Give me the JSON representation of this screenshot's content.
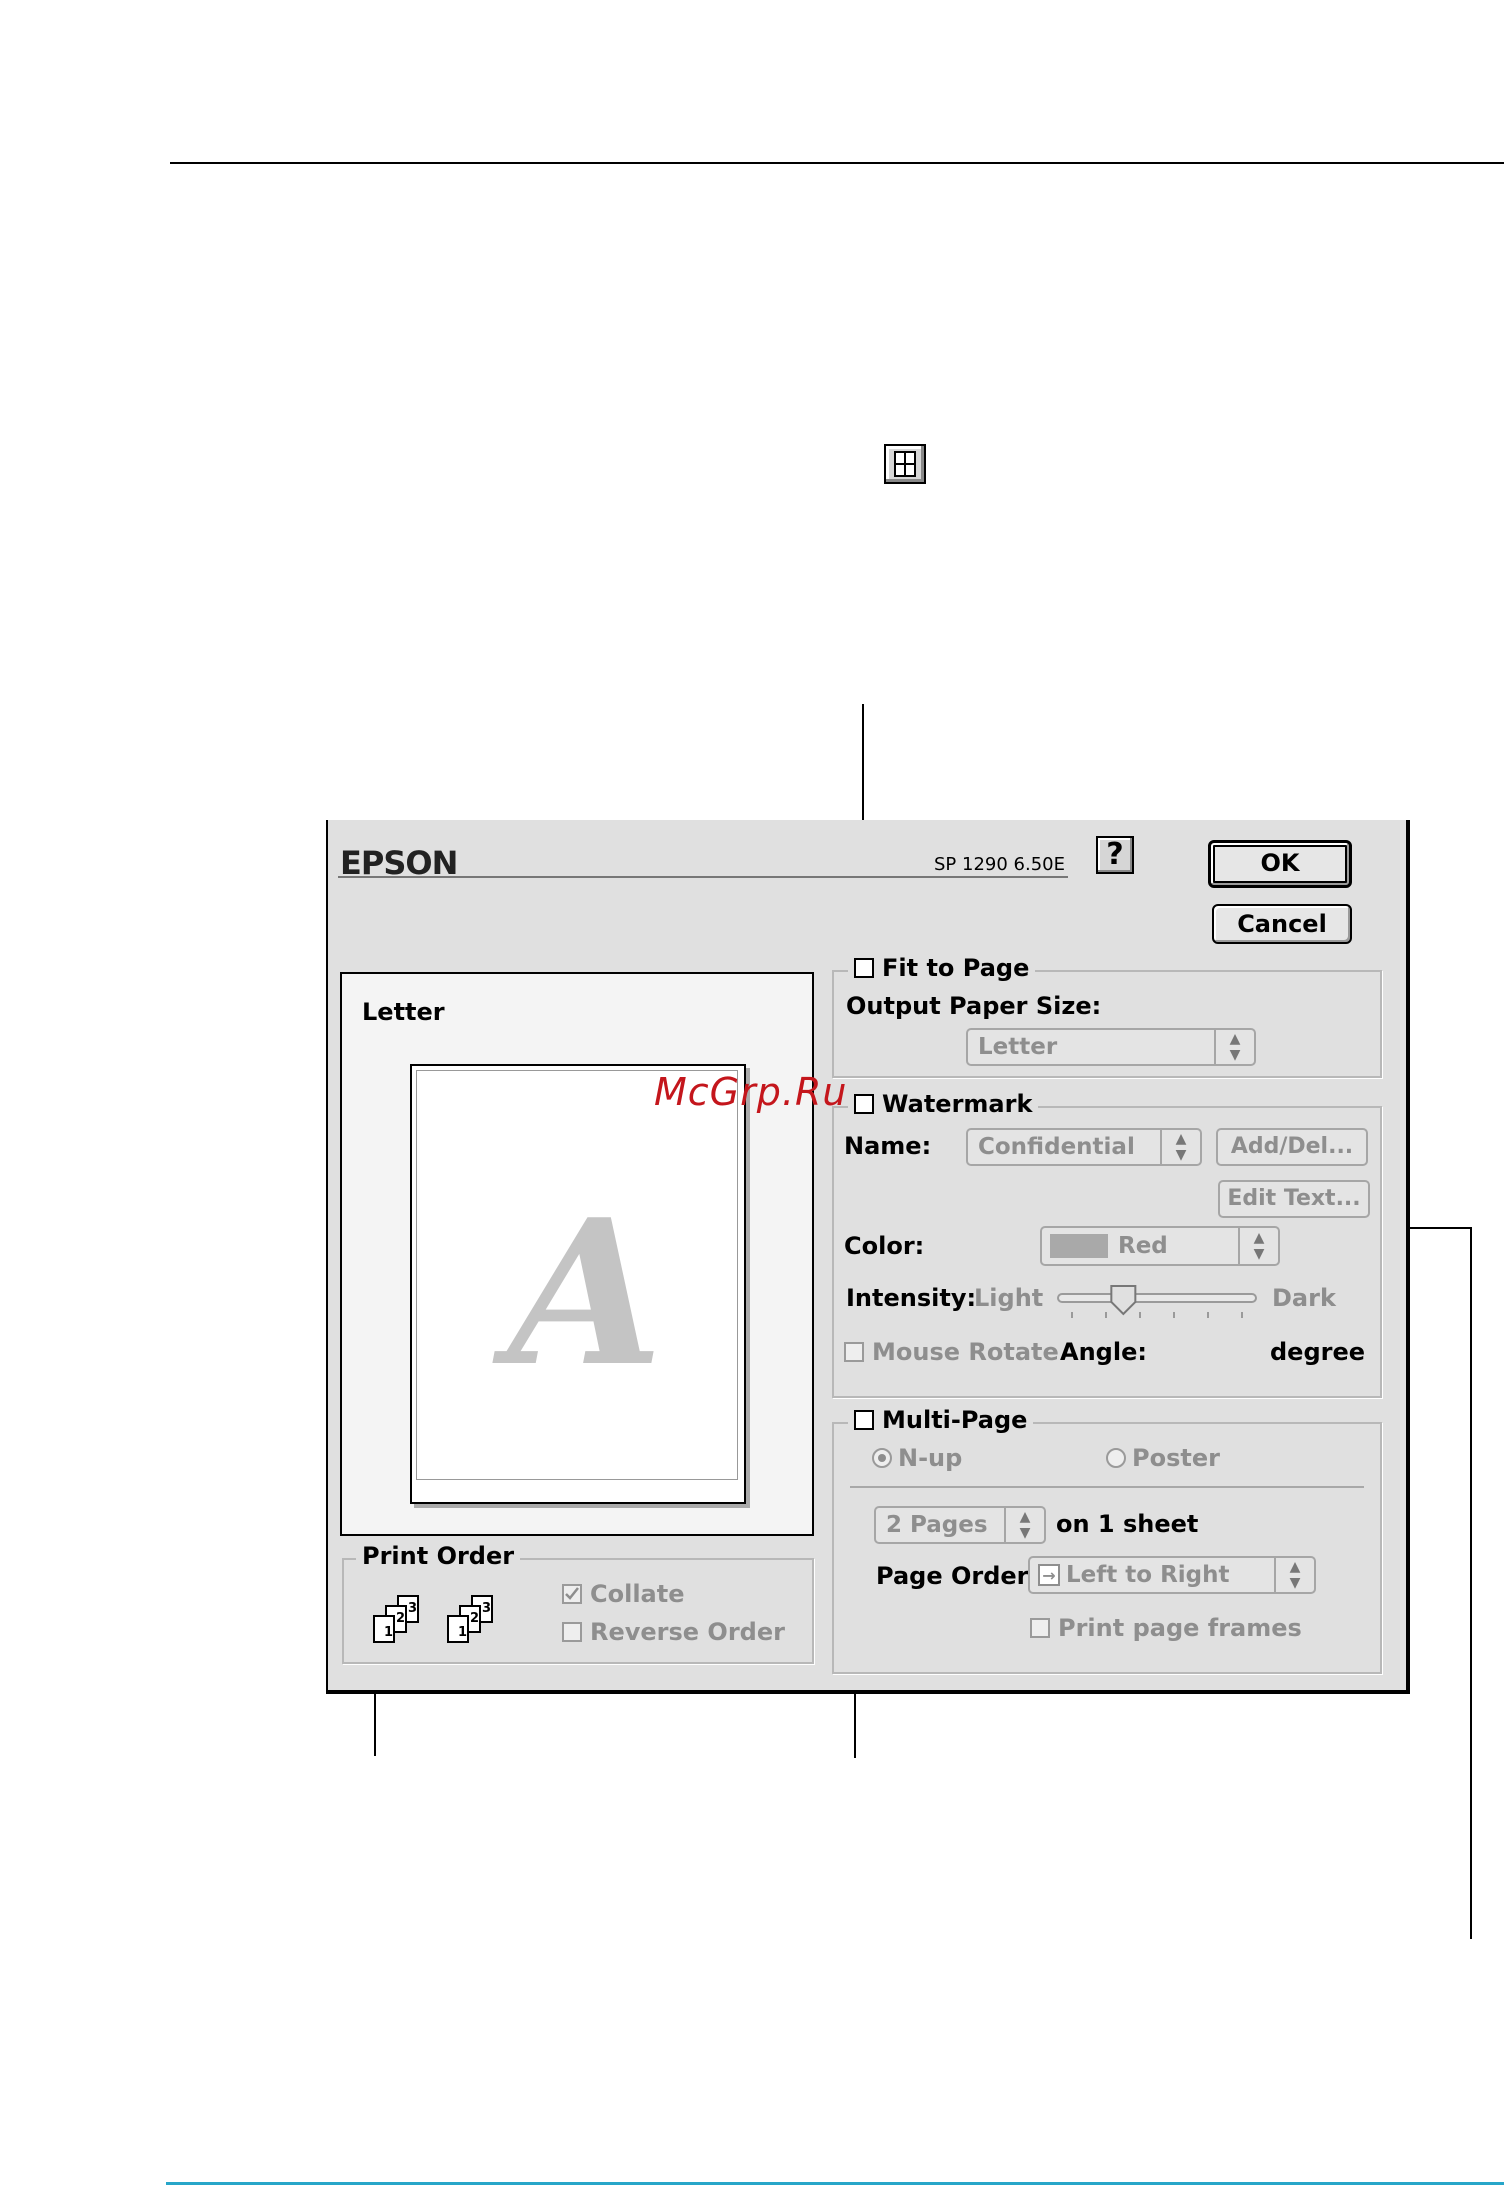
{
  "dialog": {
    "brand": "EPSON",
    "version": "SP 1290 6.50E",
    "help_label": "?",
    "ok_label": "OK",
    "cancel_label": "Cancel",
    "preview": {
      "paper_label": "Letter",
      "watermark_glyph": "A"
    },
    "fit_to_page": {
      "label": "Fit to Page",
      "output_paper_size_label": "Output Paper Size:",
      "output_paper_size_value": "Letter"
    },
    "watermark": {
      "label": "Watermark",
      "name_label": "Name:",
      "name_value": "Confidential",
      "add_del_label": "Add/Del...",
      "edit_text_label": "Edit Text...",
      "color_label": "Color:",
      "color_value": "Red",
      "intensity_label": "Intensity:",
      "light_label": "Light",
      "dark_label": "Dark",
      "intensity_level": 0.33,
      "mouse_rotate_label": "Mouse Rotate",
      "angle_label": "Angle:",
      "degree_label": "degree"
    },
    "multi_page": {
      "label": "Multi-Page",
      "nup_label": "N-up",
      "poster_label": "Poster",
      "pages_value": "2 Pages",
      "on_sheet_label": "on 1 sheet",
      "page_order_label": "Page Order:",
      "page_order_value": "Left to Right",
      "print_frames_label": "Print page frames"
    },
    "print_order": {
      "label": "Print Order",
      "collate_label": "Collate",
      "collate_checked": true,
      "reverse_label": "Reverse Order",
      "reverse_checked": false,
      "icon_digits": [
        "1",
        "2",
        "3"
      ]
    }
  },
  "site_mark": "McGrp.Ru",
  "colors": {
    "dialog_bg": "#e0e0e0",
    "disabled_text": "#8e8e8e",
    "site_mark": "#c4161c",
    "bottom_rule": "#27a6c9"
  }
}
